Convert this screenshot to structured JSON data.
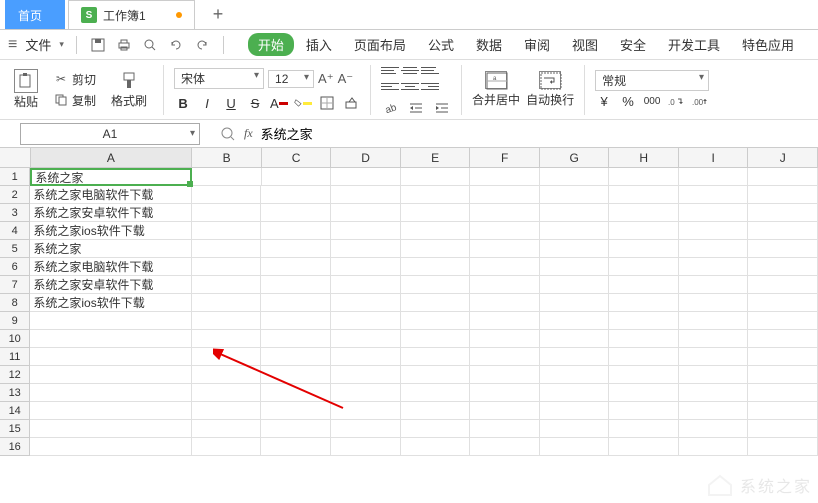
{
  "tabs": {
    "home": "首页",
    "workbook": "工作簿1"
  },
  "qat": {
    "file": "文件"
  },
  "menu": {
    "start": "开始",
    "insert": "插入",
    "page": "页面布局",
    "formula": "公式",
    "data": "数据",
    "review": "审阅",
    "view": "视图",
    "security": "安全",
    "dev": "开发工具",
    "special": "特色应用"
  },
  "ribbon": {
    "paste": "粘贴",
    "cut": "剪切",
    "copy": "复制",
    "fmtbrush": "格式刷",
    "font": "宋体",
    "size": "12",
    "merge": "合并居中",
    "wrap": "自动换行",
    "numfmt": "常规"
  },
  "namebox": "A1",
  "fxvalue": "系统之家",
  "cols": [
    "A",
    "B",
    "C",
    "D",
    "E",
    "F",
    "G",
    "H",
    "I",
    "J"
  ],
  "rows": [
    {
      "n": 1,
      "a": "系统之家"
    },
    {
      "n": 2,
      "a": "系统之家电脑软件下载"
    },
    {
      "n": 3,
      "a": "系统之家安卓软件下载"
    },
    {
      "n": 4,
      "a": "系统之家ios软件下载"
    },
    {
      "n": 5,
      "a": "系统之家"
    },
    {
      "n": 6,
      "a": "系统之家电脑软件下载"
    },
    {
      "n": 7,
      "a": "系统之家安卓软件下载"
    },
    {
      "n": 8,
      "a": "系统之家ios软件下载"
    },
    {
      "n": 9,
      "a": ""
    },
    {
      "n": 10,
      "a": ""
    },
    {
      "n": 11,
      "a": ""
    },
    {
      "n": 12,
      "a": ""
    },
    {
      "n": 13,
      "a": ""
    },
    {
      "n": 14,
      "a": ""
    },
    {
      "n": 15,
      "a": ""
    },
    {
      "n": 16,
      "a": ""
    }
  ],
  "watermark": "系统之家"
}
